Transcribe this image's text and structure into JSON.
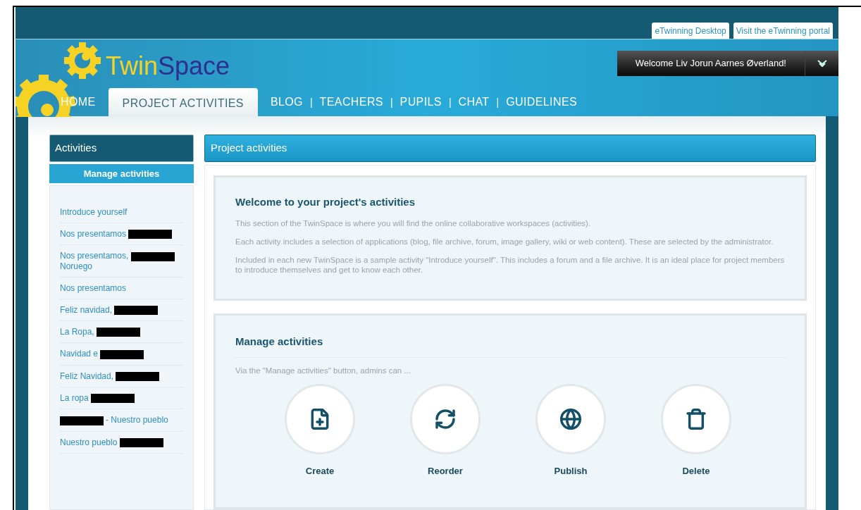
{
  "top_links": [
    "eTwinning Desktop",
    "Visit the eTwinning portal"
  ],
  "logo": {
    "part_1": "Twin",
    "part_2": "Space"
  },
  "welcome": "Welcome Liv Jorun Aarnes Øverland!",
  "nav_separator": "|",
  "nav": [
    {
      "label": "HOME",
      "selected": false
    },
    {
      "label": "PROJECT ACTIVITIES",
      "selected": true
    },
    {
      "label": "BLOG",
      "selected": false
    },
    {
      "label": "TEACHERS",
      "selected": false
    },
    {
      "label": "PUPILS",
      "selected": false
    },
    {
      "label": "CHAT",
      "selected": false
    },
    {
      "label": "GUIDELINES",
      "selected": false
    }
  ],
  "sidebar": {
    "title": "Activities",
    "button": "Manage activities",
    "items": [
      {
        "parts": [
          {
            "kind": "text",
            "text": "Introduce yourself"
          }
        ]
      },
      {
        "parts": [
          {
            "kind": "text",
            "text": "Nos presentamos"
          },
          {
            "kind": "redacted"
          }
        ]
      },
      {
        "parts": [
          {
            "kind": "text",
            "text": "Nos presentamos,"
          },
          {
            "kind": "redacted"
          },
          {
            "kind": "text",
            "text": "Noruego"
          }
        ]
      },
      {
        "parts": [
          {
            "kind": "text",
            "text": "Nos presentamos"
          }
        ]
      },
      {
        "parts": [
          {
            "kind": "text",
            "text": "Feliz navidad,"
          },
          {
            "kind": "redacted"
          }
        ]
      },
      {
        "parts": [
          {
            "kind": "text",
            "text": "La Ropa,"
          },
          {
            "kind": "redacted"
          }
        ]
      },
      {
        "parts": [
          {
            "kind": "text",
            "text": "Navidad e"
          },
          {
            "kind": "redacted"
          }
        ]
      },
      {
        "parts": [
          {
            "kind": "text",
            "text": "Feliz Navidad,"
          },
          {
            "kind": "redacted"
          }
        ]
      },
      {
        "parts": [
          {
            "kind": "text",
            "text": "La ropa"
          },
          {
            "kind": "redacted"
          }
        ]
      },
      {
        "parts": [
          {
            "kind": "redacted"
          },
          {
            "kind": "text",
            "text": "- Nuestro pueblo"
          }
        ]
      },
      {
        "parts": [
          {
            "kind": "text",
            "text": "Nuestro pueblo"
          },
          {
            "kind": "redacted"
          }
        ]
      }
    ]
  },
  "main": {
    "title": "Project activities",
    "welcome_card": {
      "heading": "Welcome to your project's activities",
      "paragraphs": [
        "This section of the TwinSpace is where you will find the online collaborative workspaces (activities).",
        "Each activity includes a selection of applications (blog, file archive, forum, image gallery, wiki or web content). These are selected by the administrator.",
        "Included in each new TwinSpace is a sample activity \"Introduce yourself\". This includes a forum and a file archive. It is an ideal place for project members to introduce themselves and get to know each other."
      ]
    },
    "manage_card": {
      "heading": "Manage activities",
      "intro": "Via the \"Manage activities\" button, admins can ...",
      "actions": [
        {
          "kind": "create",
          "label": "Create"
        },
        {
          "kind": "reorder",
          "label": "Reorder"
        },
        {
          "kind": "publish",
          "label": "Publish"
        },
        {
          "kind": "delete",
          "label": "Delete"
        }
      ]
    }
  }
}
